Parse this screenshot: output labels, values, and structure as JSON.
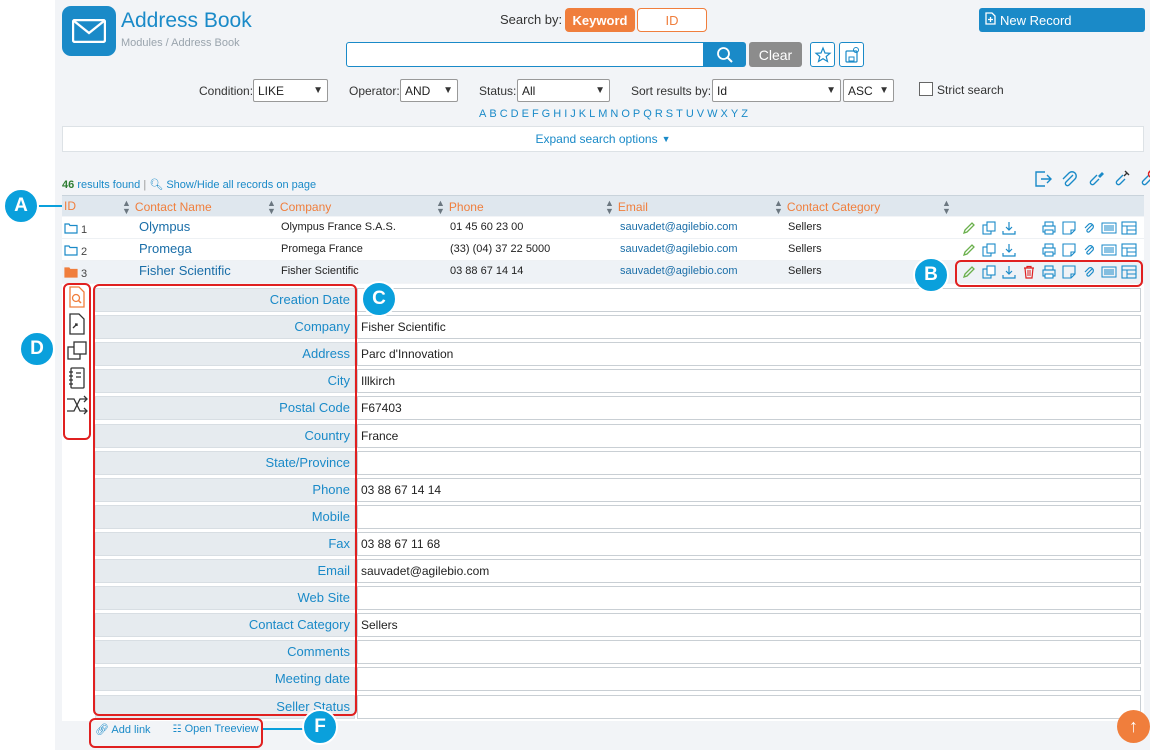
{
  "header": {
    "title": "Address Book",
    "breadcrumb": "Modules / Address Book",
    "search_by_label": "Search by:",
    "keyword_btn": "Keyword",
    "id_btn": "ID",
    "new_record": "New Record",
    "clear": "Clear",
    "search_value": ""
  },
  "filters": {
    "condition_label": "Condition:",
    "condition_value": "LIKE",
    "operator_label": "Operator:",
    "operator_value": "AND",
    "status_label": "Status:",
    "status_value": "All",
    "sort_label": "Sort results by:",
    "sort_value": "Id",
    "sort_dir": "ASC",
    "strict_label": "Strict search"
  },
  "alphabet": [
    "A",
    "B",
    "C",
    "D",
    "E",
    "F",
    "G",
    "H",
    "I",
    "J",
    "K",
    "L",
    "M",
    "N",
    "O",
    "P",
    "Q",
    "R",
    "S",
    "T",
    "U",
    "V",
    "W",
    "X",
    "Y",
    "Z"
  ],
  "expand_label": "Expand search options",
  "results": {
    "count": "46",
    "count_text": "results found",
    "toggle_text": "Show/Hide all records on page"
  },
  "table": {
    "headers": [
      "ID",
      "Contact Name",
      "Company",
      "Phone",
      "Email",
      "Contact Category"
    ],
    "rows": [
      {
        "id": "1",
        "name": "Olympus",
        "company": "Olympus France S.A.S.",
        "phone": "01 45 60 23 00",
        "email": "sauvadet@agilebio.com",
        "category": "Sellers"
      },
      {
        "id": "2",
        "name": "Promega",
        "company": "Promega France",
        "phone": "(33) (04) 37 22 5000",
        "email": "sauvadet@agilebio.com",
        "category": "Sellers"
      },
      {
        "id": "3",
        "name": "Fisher Scientific",
        "company": "Fisher Scientific",
        "phone": "03 88 67 14 14",
        "email": "sauvadet@agilebio.com",
        "category": "Sellers"
      }
    ]
  },
  "detail": {
    "fields": [
      {
        "label": "Creation Date",
        "value": ""
      },
      {
        "label": "Company",
        "value": "Fisher Scientific"
      },
      {
        "label": "Address",
        "value": "Parc d'Innovation"
      },
      {
        "label": "City",
        "value": "Illkirch"
      },
      {
        "label": "Postal Code",
        "value": "F67403"
      },
      {
        "label": "Country",
        "value": "France"
      },
      {
        "label": "State/Province",
        "value": ""
      },
      {
        "label": "Phone",
        "value": "03 88 67 14 14"
      },
      {
        "label": "Mobile",
        "value": ""
      },
      {
        "label": "Fax",
        "value": "03 88 67 11 68"
      },
      {
        "label": "Email",
        "value": "sauvadet@agilebio.com"
      },
      {
        "label": "Web Site",
        "value": ""
      },
      {
        "label": "Contact Category",
        "value": "Sellers"
      },
      {
        "label": "Comments",
        "value": ""
      },
      {
        "label": "Meeting date",
        "value": ""
      },
      {
        "label": "Seller Status",
        "value": ""
      }
    ]
  },
  "footer": {
    "add_link": "Add link",
    "open_treeview": "Open Treeview"
  },
  "annotations": {
    "a": "A",
    "b": "B",
    "c": "C",
    "d": "D",
    "f": "F"
  },
  "colors": {
    "accent_blue": "#1a8ac8",
    "accent_orange": "#f07e3c",
    "annotation_blue": "#0aa0dc",
    "annotation_red": "#e02020"
  }
}
